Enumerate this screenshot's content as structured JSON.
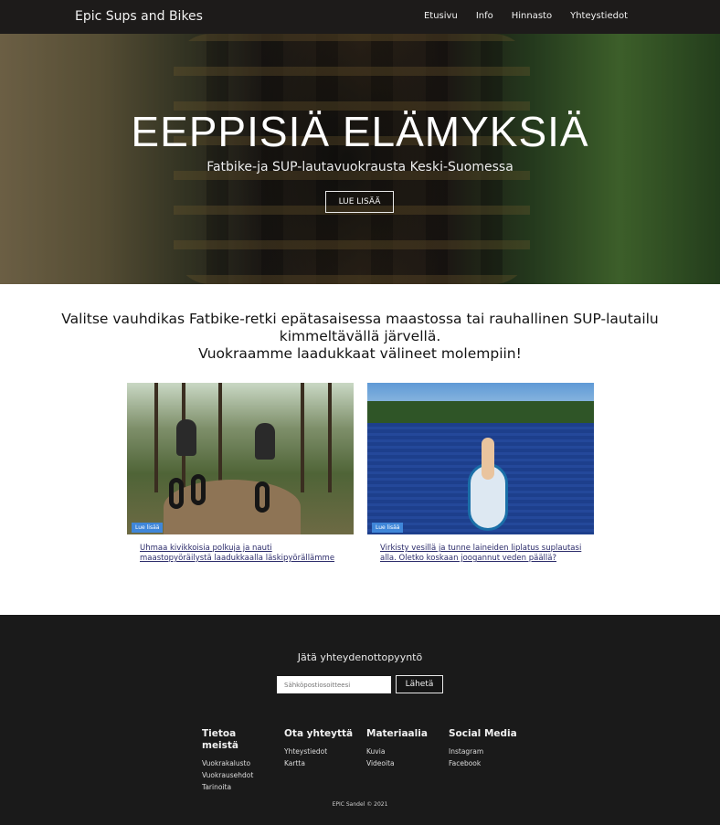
{
  "nav": {
    "brand": "Epic Sups and Bikes",
    "links": [
      "Etusivu",
      "Info",
      "Hinnasto",
      "Yhteystiedot"
    ]
  },
  "hero": {
    "title": "EEPPISIÄ ELÄMYKSIÄ",
    "subtitle": "Fatbike-ja SUP-lautavuokrausta Keski-Suomessa",
    "button": "LUE LISÄÄ"
  },
  "intro": {
    "line1": "Valitse vauhdikas Fatbike-retki epätasaisessa maastossa tai rauhallinen SUP-lautailu",
    "line2": "kimmeltävällä järvellä.",
    "line3": "Vuokraamme laadukkaat välineet molempiin!"
  },
  "cards": [
    {
      "badge": "Lue lisää",
      "link": "Uhmaa kivikkoisia polkuja ja nauti maastopyöräilystä laadukkaalla läskipyörällämme"
    },
    {
      "badge": "Lue lisää",
      "link": "Virkisty vesillä ja tunne laineiden liplatus suplautasi alla. Oletko koskaan joogannut veden päällä?"
    }
  ],
  "footer": {
    "contact_title": "Jätä yhteydenottopyyntö",
    "email_placeholder": "Sähköpostiosoitteesi",
    "send": "Lähetä",
    "columns": [
      {
        "title": "Tietoa meistä",
        "items": [
          "Vuokrakalusto",
          "Vuokrausehdot",
          "Tarinoita"
        ]
      },
      {
        "title": "Ota yhteyttä",
        "items": [
          "Yhteystiedot",
          "Kartta"
        ]
      },
      {
        "title": "Materiaalia",
        "items": [
          "Kuvia",
          "Videoita"
        ]
      },
      {
        "title": "Social Media",
        "items": [
          "Instagram",
          "Facebook"
        ]
      }
    ],
    "copyright": "EPIC Sandel © 2021"
  },
  "colors": {
    "nav_bg": "#1d1b1a",
    "footer_bg": "#1a1a1a",
    "badge": "#3f86d9",
    "link": "#2b2b6a"
  }
}
